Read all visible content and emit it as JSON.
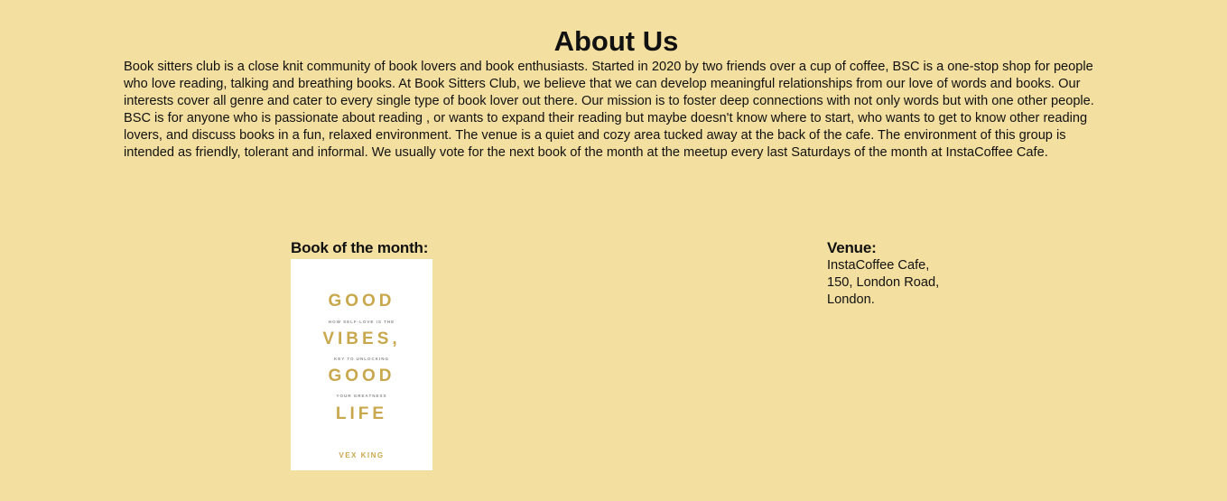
{
  "about": {
    "title": "About Us",
    "paragraph1": "Book sitters club is a close knit community of book lovers and book enthusiasts. Started in 2020 by two friends over a cup of coffee, BSC is a one-stop shop for people who love reading, talking and breathing books. At Book Sitters Club, we believe that we can develop meaningful relationships from our love of words and books. Our interests cover all genre and cater to every single type of book lover out there. Our mission is to foster deep connections with not only words but with one other people.",
    "paragraph2": "BSC is for anyone who is passionate about reading , or wants to expand their reading but maybe doesn't know where to start, who wants to get to know other reading lovers, and discuss books in a fun, relaxed environment. The venue is a quiet and cozy area tucked away at the back of the cafe. The environment of this group is intended as friendly, tolerant and informal. We usually vote for the next book of the month at the meetup every last Saturdays of the month at InstaCoffee Cafe."
  },
  "book_of_month": {
    "heading": "Book of the month:",
    "cover": {
      "title_word1": "GOOD",
      "subtitle1": "HOW SELF-LOVE IS THE",
      "title_word2": "VIBES,",
      "subtitle2": "KEY TO UNLOCKING",
      "title_word3": "GOOD",
      "subtitle3": "YOUR GREATNESS",
      "title_word4": "LIFE",
      "author": "VEX KING"
    }
  },
  "venue": {
    "heading": "Venue:",
    "line1": "InstaCoffee Cafe,",
    "line2": "150, London Road,",
    "line3": "London."
  }
}
